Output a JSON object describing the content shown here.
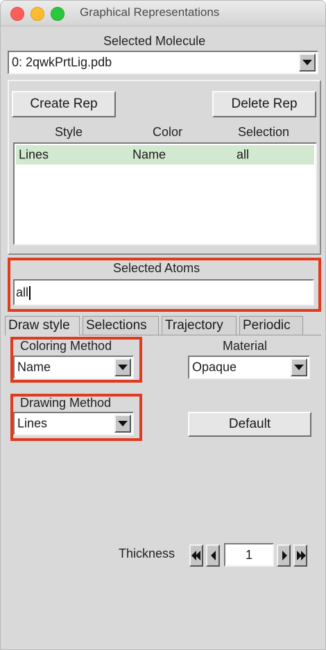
{
  "window": {
    "title": "Graphical Representations"
  },
  "molecule": {
    "label": "Selected Molecule",
    "value": "0: 2qwkPrtLig.pdb"
  },
  "reps": {
    "create_label": "Create Rep",
    "delete_label": "Delete Rep",
    "columns": [
      "Style",
      "Color",
      "Selection"
    ],
    "rows": [
      {
        "style": "Lines",
        "color": "Name",
        "selection": "all"
      }
    ]
  },
  "atoms": {
    "label": "Selected Atoms",
    "value": "all"
  },
  "tabs": [
    "Draw style",
    "Selections",
    "Trajectory",
    "Periodic"
  ],
  "draw": {
    "coloring_label": "Coloring Method",
    "coloring_value": "Name",
    "material_label": "Material",
    "material_value": "Opaque",
    "drawing_label": "Drawing Method",
    "drawing_value": "Lines",
    "default_label": "Default",
    "thickness_label": "Thickness",
    "thickness_value": "1"
  },
  "colors": {
    "highlight": "#e03a1f",
    "selected_row": "#d3e8d0"
  }
}
